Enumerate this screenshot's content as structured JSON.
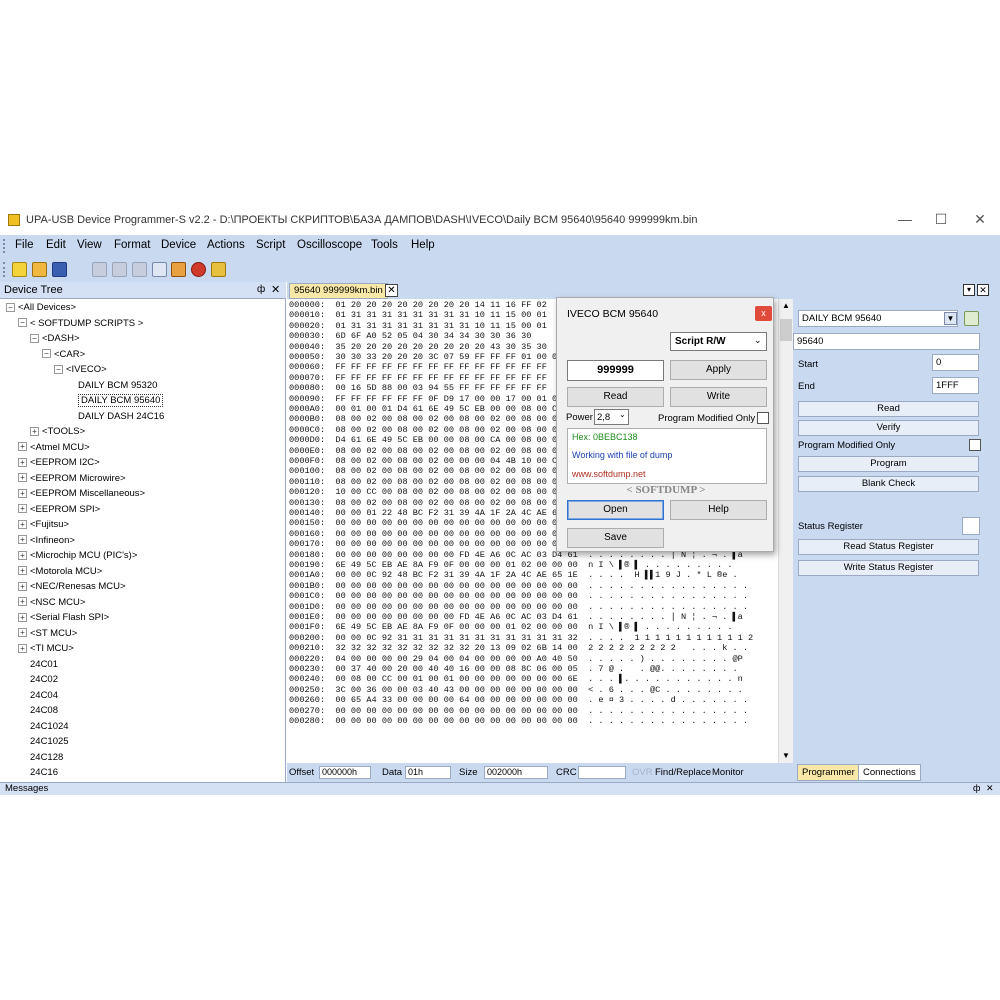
{
  "window": {
    "title": "UPA-USB Device Programmer-S v2.2 - D:\\ПРОЕКТЫ СКРИПТОВ\\БАЗА ДАМПОВ\\DASH\\IVECO\\Daily BCM 95640\\95640 999999km.bin",
    "min": "—",
    "max": "☐",
    "close": "✕"
  },
  "menu": [
    "File",
    "Edit",
    "View",
    "Format",
    "Device",
    "Actions",
    "Script",
    "Oscilloscope",
    "Tools",
    "Help"
  ],
  "tree": {
    "header": "Device Tree",
    "pin": "ф",
    "close": "✕",
    "items": [
      {
        "label": "<All Devices>",
        "exp": "⊟"
      },
      {
        "label": "< SOFTDUMP SCRIPTS >",
        "exp": "⊟"
      },
      {
        "label": "<DASH>",
        "exp": "⊟"
      },
      {
        "label": "<CAR>",
        "exp": "⊟"
      },
      {
        "label": "<IVECO>",
        "exp": "⊟"
      },
      {
        "label": "DAILY BCM 95320",
        "exp": ""
      },
      {
        "label": "DAILY BCM 95640",
        "exp": ""
      },
      {
        "label": "DAILY DASH 24C16",
        "exp": ""
      },
      {
        "label": "<TOOLS>",
        "exp": "⊞"
      },
      {
        "label": "<Atmel MCU>",
        "exp": "⊞"
      },
      {
        "label": "<EEPROM I2C>",
        "exp": "⊞"
      },
      {
        "label": "<EEPROM Microwire>",
        "exp": "⊞"
      },
      {
        "label": "<EEPROM Miscellaneous>",
        "exp": "⊞"
      },
      {
        "label": "<EEPROM SPI>",
        "exp": "⊞"
      },
      {
        "label": "<Fujitsu>",
        "exp": "⊞"
      },
      {
        "label": "<Infineon>",
        "exp": "⊞"
      },
      {
        "label": "<Microchip MCU (PIC's)>",
        "exp": "⊞"
      },
      {
        "label": "<Motorola MCU>",
        "exp": "⊞"
      },
      {
        "label": "<NEC/Renesas MCU>",
        "exp": "⊞"
      },
      {
        "label": "<NSC MCU>",
        "exp": "⊞"
      },
      {
        "label": "<Serial Flash SPI>",
        "exp": "⊞"
      },
      {
        "label": "<ST MCU>",
        "exp": "⊞"
      },
      {
        "label": "<TI MCU>",
        "exp": "⊞"
      },
      {
        "label": "24C01",
        "exp": ""
      },
      {
        "label": "24C02",
        "exp": ""
      },
      {
        "label": "24C04",
        "exp": ""
      },
      {
        "label": "24C08",
        "exp": ""
      },
      {
        "label": "24C1024",
        "exp": ""
      },
      {
        "label": "24C1025",
        "exp": ""
      },
      {
        "label": "24C128",
        "exp": ""
      },
      {
        "label": "24C16",
        "exp": ""
      }
    ]
  },
  "hex": {
    "tab": "95640 999999km.bin",
    "tab_close": "✕",
    "rows": [
      "000000:  01 20 20 20 20 20 20 20 20 14 11 16 FF 02",
      "000010:  01 31 31 31 31 31 31 31 31 10 11 15 00 01",
      "000020:  01 31 31 31 31 31 31 31 31 10 11 15 00 01",
      "000030:  6D 6F A0 52 05 04 30 34 34 30 30 36 30",
      "000040:  35 20 20 20 20 20 20 20 20 20 43 30 35 30",
      "000050:  30 30 33 20 20 20 3C 07 59 FF FF FF 01 00 03",
      "000060:  FF FF FF FF FF FF FF FF FF FF FF FF FF FF",
      "000070:  FF FF FF FF FF FF FF FF FF FF FF FF FF FF",
      "000080:  00 16 5D 88 00 03 94 55 FF FF FF FF FF FF",
      "000090:  FF FF FF FF FF FF 0F D9 17 00 00 17 00 01 00",
      "0000A0:  00 01 00 01 D4 61 6E 49 5C EB 00 00 08 00 CA",
      "0000B0:  08 00 02 00 08 00 02 00 08 00 02 00 08 00 02",
      "0000C0:  08 00 02 00 08 00 02 00 08 00 02 00 08 00 04",
      "0000D0:  D4 61 6E 49 5C EB 00 00 08 00 CA 00 08 00 02",
      "0000E0:  08 00 02 00 08 00 02 00 08 00 02 00 08 00 02",
      "0000F0:  08 00 02 00 08 00 02 00 00 00 04 4B 10 00 CC",
      "000100:  08 00 02 00 08 00 02 00 08 00 02 00 08 00 02",
      "000110:  08 00 02 00 08 00 02 00 08 00 02 00 08 00 01",
      "000120:  10 00 CC 00 08 00 02 00 08 00 02 00 08 00 02",
      "000130:  08 00 02 00 08 00 02 00 08 00 02 00 08 00 02",
      "000140:  00 00 01 22 48 BC F2 31 39 4A 1F 2A 4C AE 65",
      "000150:  00 00 00 00 00 00 00 00 00 00 00 00 00 00 00",
      "000160:  00 00 00 00 00 00 00 00 00 00 00 00 00 00 00 00  . . . . . . . . . . . . . . . .",
      "000170:  00 00 00 00 00 00 00 00 00 00 00 00 00 00 00 00  . . . . . . . . . . . . . . . .",
      "000180:  00 00 00 00 00 00 00 00 FD 4E A6 0C AC 03 D4 61  . . . . . . . . ∣ N ¦ . ¬ . ▌a",
      "000190:  6E 49 5C EB AE 8A F9 0F 00 00 00 01 02 00 00 00  n I \\ ▌® ▌ . . . . . . . . .",
      "0001A0:  00 00 0C 92 48 BC F2 31 39 4A 1F 2A 4C AE 65 1E  . . . .  H ▌▌1 9 J . * L ®e .",
      "0001B0:  00 00 00 00 00 00 00 00 00 00 00 00 00 00 00 00  . . . . . . . . . . . . . . . .",
      "0001C0:  00 00 00 00 00 00 00 00 00 00 00 00 00 00 00 00  . . . . . . . . . . . . . . . .",
      "0001D0:  00 00 00 00 00 00 00 00 00 00 00 00 00 00 00 00  . . . . . . . . . . . . . . . .",
      "0001E0:  00 00 00 00 00 00 00 00 FD 4E A6 0C AC 03 D4 61  . . . . . . . . ∣ N ¦ . ¬ . ▌a",
      "0001F0:  6E 49 5C EB AE 8A F9 0F 00 00 00 01 02 00 00 00  n I \\ ▌® ▌ . . . . . . . . .",
      "000200:  00 00 0C 92 31 31 31 31 31 31 31 31 31 31 31 32  . . . .  1 1 1 1 1 1 1 1 1 1 1 2",
      "000210:  32 32 32 32 32 32 32 32 32 20 13 09 02 6B 14 00  2 2 2 2 2 2 2 2 2   . . . k . .",
      "000220:  04 00 00 00 00 29 04 00 04 00 00 00 00 A0 40 50  . . . . . ) . . . . . . . . @P",
      "000230:  00 37 40 00 20 00 40 40 16 00 00 08 8C 06 00 05  . 7 @ .   . @@. . . . . . . .",
      "000240:  00 08 00 CC 00 01 00 01 00 00 00 00 00 00 00 6E  . . . ▌. . . . . . . . . . . n",
      "000250:  3C 00 36 00 00 03 40 43 00 00 00 00 00 00 00 00  < . 6 . . . @C . . . . . . . .",
      "000260:  00 65 A4 33 00 00 00 00 64 00 00 00 00 00 00 00  . e ¤ 3 . . . . d . . . . . . .",
      "000270:  00 00 00 00 00 00 00 00 00 00 00 00 00 00 00 00  . . . . . . . . . . . . . . . .",
      "000280:  00 00 00 00 00 00 00 00 00 00 00 00 00 00 00 00  . . . . . . . . . . . . . . . ."
    ]
  },
  "status": {
    "offset_label": "Offset",
    "offset": "000000h",
    "data_label": "Data",
    "data": "01h",
    "size_label": "Size",
    "size": "002000h",
    "crc_label": "CRC",
    "crc": "",
    "ovr": "OVR",
    "find": "Find/Replace",
    "monitor": "Monitor"
  },
  "dialog": {
    "title": "IVECO BCM 95640",
    "close": "x",
    "mode": "Script R/W",
    "value": "999999",
    "apply": "Apply",
    "read": "Read",
    "write": "Write",
    "power_label": "Power",
    "power": "2,8",
    "pmo_label": "Program Modified Only",
    "hex_line": "Hex: 0BEBC138",
    "working": "Working with file of dump",
    "url": "www.softdump.net",
    "brand": "< SOFTDUMP >",
    "open": "Open",
    "help": "Help",
    "save": "Save",
    "colors": {
      "hex": "#1a8a1a",
      "working": "#1a3fb0",
      "url": "#b03020"
    }
  },
  "right": {
    "device": "DAILY BCM 95640",
    "chip": "95640",
    "start_label": "Start",
    "start": "0",
    "end_label": "End",
    "end": "1FFF",
    "read": "Read",
    "verify": "Verify",
    "pmo_label": "Program Modified Only",
    "program": "Program",
    "blank_check": "Blank Check",
    "status_reg_label": "Status Register",
    "read_status": "Read Status Register",
    "write_status": "Write Status Register",
    "tabs": [
      "Programmer",
      "Connections"
    ]
  },
  "messages": {
    "label": "Messages",
    "pin": "ф",
    "close": "✕"
  },
  "colors": {
    "bar": "#c9d9f0",
    "tab_active": "#f7e8a8"
  }
}
